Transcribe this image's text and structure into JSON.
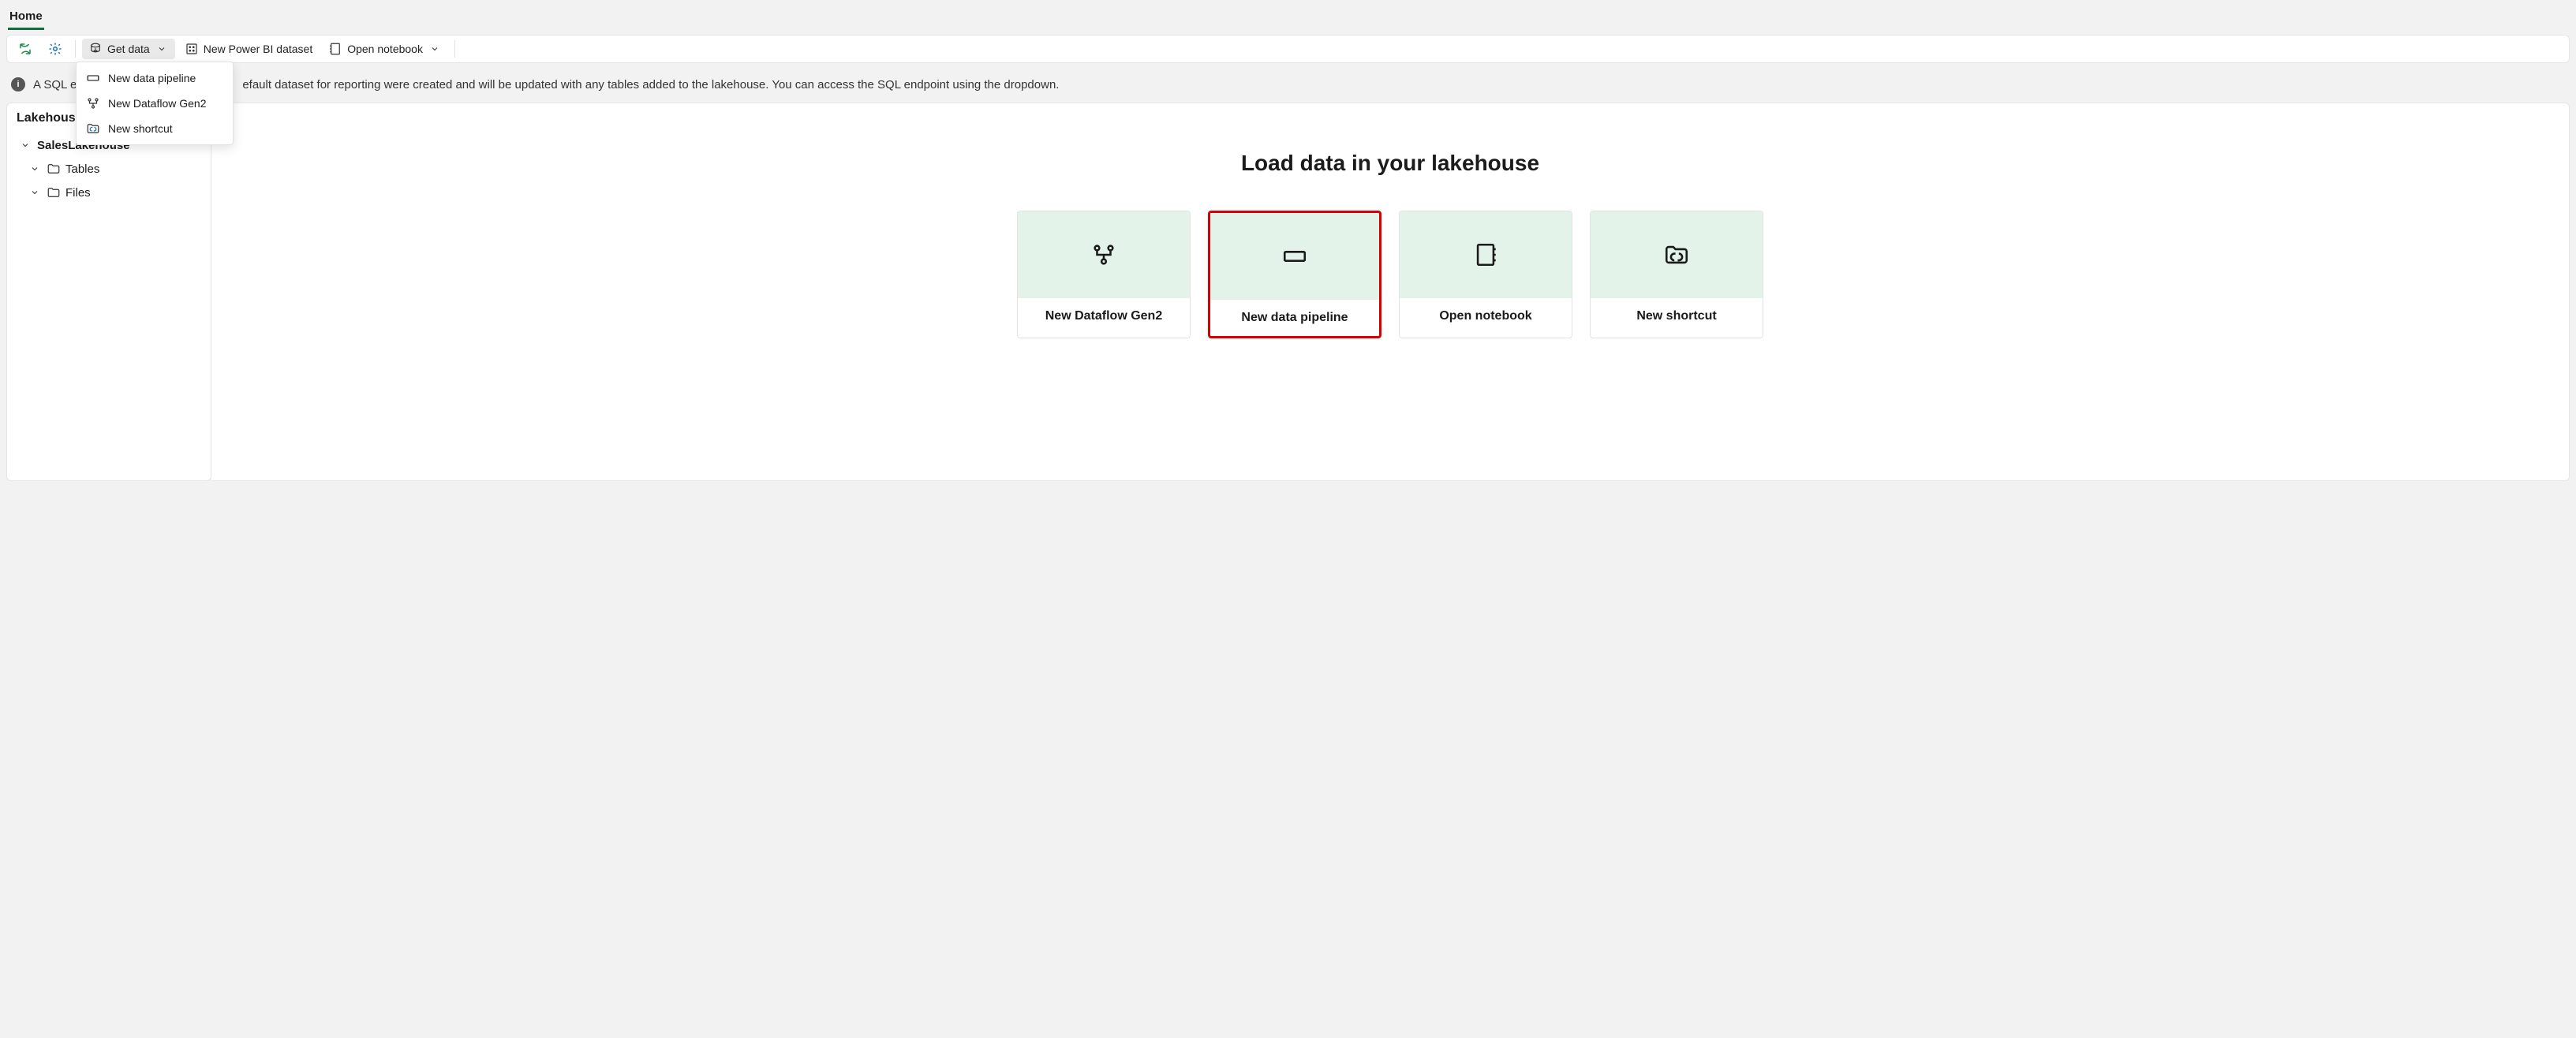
{
  "tabstrip": {
    "active": "Home"
  },
  "toolbar": {
    "get_data_label": "Get data",
    "new_dataset_label": "New Power BI dataset",
    "open_notebook_label": "Open notebook"
  },
  "get_data_menu": {
    "items": [
      {
        "label": "New data pipeline"
      },
      {
        "label": "New Dataflow Gen2"
      },
      {
        "label": "New shortcut"
      }
    ]
  },
  "infobar": {
    "visible_fragment_left": "A SQL e",
    "visible_fragment_right": "efault dataset for reporting were created and will be updated with any tables added to the lakehouse. You can access the SQL endpoint using the dropdown."
  },
  "explorer": {
    "title": "Lakehous",
    "root": "SalesLakehouse",
    "nodes": [
      {
        "label": "Tables"
      },
      {
        "label": "Files"
      }
    ]
  },
  "canvas": {
    "hero": "Load data in your lakehouse",
    "cards": [
      {
        "label": "New Dataflow Gen2"
      },
      {
        "label": "New data pipeline",
        "highlight": true
      },
      {
        "label": "Open notebook"
      },
      {
        "label": "New shortcut"
      }
    ]
  }
}
